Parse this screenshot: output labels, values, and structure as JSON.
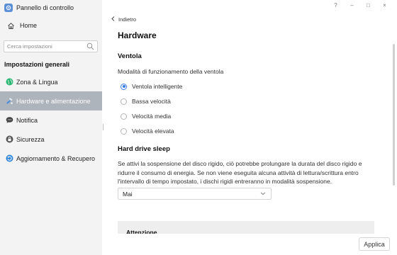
{
  "window": {
    "title": "Pannello di controllo",
    "help": "?",
    "minimize": "–",
    "maximize": "□",
    "close": "×"
  },
  "sidebar": {
    "home_label": "Home",
    "search_placeholder": "Cerca impostazioni",
    "section_header": "Impostazioni generali",
    "items": [
      {
        "label": "Zona & Lingua",
        "icon": "globe-icon"
      },
      {
        "label": "Hardware e alimentazione",
        "icon": "hardware-icon",
        "active": true
      },
      {
        "label": "Notifica",
        "icon": "chat-icon"
      },
      {
        "label": "Sicurezza",
        "icon": "lock-icon"
      },
      {
        "label": "Aggiornamento & Recupero",
        "icon": "update-icon"
      }
    ]
  },
  "main": {
    "back_label": "Indietro",
    "page_title": "Hardware",
    "fan": {
      "title": "Ventola",
      "description": "Modalità di funzionamento della ventola",
      "options": [
        {
          "label": "Ventola intelligente",
          "checked": true
        },
        {
          "label": "Bassa velocità",
          "checked": false
        },
        {
          "label": "Velocità media",
          "checked": false
        },
        {
          "label": "Velocità elevata",
          "checked": false
        }
      ]
    },
    "sleep": {
      "title": "Hard drive sleep",
      "paragraph": "Se attivi la sospensione del disco rigido, ciò potrebbe prolungare la durata del disco rigido e ridurre il consumo di energia. Se non viene eseguita alcuna attività di lettura/scrittura entro l'intervallo di tempo impostato, i dischi rigidi entreranno in modalità sospensione.",
      "selected": "Mai"
    },
    "warning_title": "Attenzione"
  },
  "footer": {
    "apply_label": "Applica"
  },
  "colors": {
    "accent": "#3a7be0",
    "active_item_bg": "#aeb4bc",
    "sidebar_bg": "#f3f3f3"
  }
}
